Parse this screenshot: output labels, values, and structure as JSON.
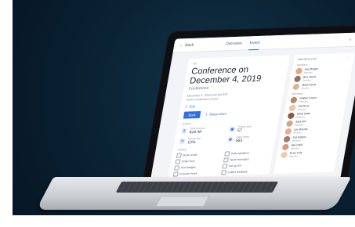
{
  "topbar": {
    "back_label": "Back",
    "tabs": [
      "Overview",
      "Event"
    ],
    "active_tab_index": 1
  },
  "event": {
    "breadcrumb": "All",
    "title": "Conference on December 4, 2019",
    "subtitle": "Conference",
    "meta_line_1": "December 4, 2019 9:00 AM EST",
    "meta_line_2": "Acme Conference Center",
    "edit_label": "Edit",
    "primary_action": "Book",
    "secondary_action": "Share event"
  },
  "stats": {
    "section_label": "Stats",
    "items": [
      {
        "label": "Total revenue",
        "value": "$16.4K",
        "icon": "dollar-icon"
      },
      {
        "label": "Tickets sold",
        "value": "57",
        "icon": "ticket-icon"
      },
      {
        "label": "Conversion",
        "value": "12%",
        "icon": "percent-icon"
      },
      {
        "label": "Page views",
        "value": "563",
        "icon": "eye-icon"
      }
    ]
  },
  "tasks": {
    "section_label": "Tasks",
    "items": [
      "Book venue",
      "Invite speakers",
      "Order food",
      "Send reminders",
      "Print badges",
      "Set up A/V",
      "Promote event",
      "Collect feedback"
    ]
  },
  "attendees": {
    "header": "Attendees (14)",
    "more_icon": "more-icon",
    "groups": [
      {
        "title": "Speakers",
        "people": [
          {
            "name": "Ana Wright",
            "role": "Speaker",
            "color": "#e8a47a"
          },
          {
            "name": "Ben Harris",
            "role": "Speaker",
            "color": "#9a6e5a"
          },
          {
            "name": "Maya Stone",
            "role": "Speaker",
            "color": "#d9b49a"
          }
        ]
      },
      {
        "title": "Attendees",
        "people": [
          {
            "name": "Nathan Green",
            "role": "Attendee",
            "color": "#b88762"
          },
          {
            "name": "Lila Ross",
            "role": "Attendee",
            "color": "#f0c3a6"
          },
          {
            "name": "Omar Patel",
            "role": "Attendee",
            "color": "#8c5a42"
          },
          {
            "name": "Sara Kim",
            "role": "Attendee",
            "color": "#cfa789"
          },
          {
            "name": "Leo Brooks",
            "role": "Attendee",
            "color": "#e2b195"
          },
          {
            "name": "Zoe Adams",
            "role": "Attendee",
            "color": "#a87962"
          },
          {
            "name": "Mia Clark",
            "role": "Attendee",
            "color": "#d5997b"
          },
          {
            "name": "Evan Cole",
            "role": "Attendee",
            "color": "#f3c8aa"
          }
        ]
      }
    ]
  }
}
